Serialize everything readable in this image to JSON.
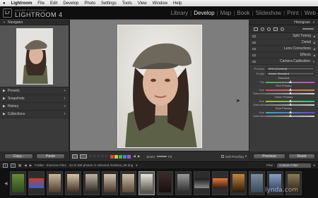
{
  "menubar": {
    "app": "Lightroom",
    "items": [
      "File",
      "Edit",
      "Develop",
      "Photo",
      "Settings",
      "Tools",
      "View",
      "Window",
      "Help"
    ]
  },
  "identity": {
    "logo": "Lr",
    "subtitle": "ADOBE PHOTOSHOP",
    "title": "LIGHTROOM 4"
  },
  "modules": [
    "Library",
    "Develop",
    "Map",
    "Book",
    "Slideshow",
    "Print",
    "Web"
  ],
  "active_module": "Develop",
  "left_panel": {
    "navigator": {
      "title": "Navigator",
      "zoom_options": [
        "FIT",
        "FILL",
        "1:1",
        "3:1"
      ]
    },
    "sections": [
      "Presets",
      "Snapshots",
      "History",
      "Collections"
    ],
    "copy_label": "Copy...",
    "paste_label": "Paste"
  },
  "toolbar": {
    "stars": "☆☆☆☆☆",
    "zoom_label": "Zoom:",
    "zoom_value": "Fit",
    "soft_proofing": "Soft Proofing",
    "flag_colors": [
      "#d44a4a",
      "#d2c33a",
      "#4bb04b",
      "#4a7fd4",
      "#9a5ad1"
    ]
  },
  "right_panel": {
    "histogram": "Histogram",
    "sections": [
      "Split Toning",
      "Detail",
      "Lens Corrections",
      "Effects",
      "Camera Calibration"
    ],
    "calibration": {
      "process_label": "Process",
      "process_value": "2012 (Current)",
      "profile_label": "Profile",
      "profile_value": "Adobe Standard",
      "groups": [
        {
          "name": "Shadows",
          "sliders": [
            {
              "label": "Tint",
              "value": 0.5
            }
          ]
        },
        {
          "name": "Red Primary",
          "sliders": [
            {
              "label": "Hue",
              "value": 0.5
            },
            {
              "label": "Saturation",
              "value": 0.5
            }
          ]
        },
        {
          "name": "Green Primary",
          "sliders": [
            {
              "label": "Hue",
              "value": 0.5
            },
            {
              "label": "Saturation",
              "value": 0.5
            }
          ]
        },
        {
          "name": "Blue Primary",
          "sliders": [
            {
              "label": "Hue",
              "value": 0.5
            },
            {
              "label": "Saturation",
              "value": 0.5
            }
          ]
        }
      ]
    },
    "previous_label": "Previous",
    "reset_label": "Reset"
  },
  "filmstrip": {
    "monitor_1": "1",
    "monitor_2": "2",
    "folder": "Folder : Exercise Files",
    "count": "43 of 105 photos /1 selected /melissa_06.dng",
    "filter_label": "Filter :",
    "filter_value": "Custom Filter",
    "thumbnails": [
      {
        "colors": [
          "#6a8b3a",
          "#2b4a1b"
        ],
        "landscape": false
      },
      {
        "colors": [
          "#c0402b",
          "#3b5fbf"
        ],
        "landscape": true
      },
      {
        "colors": [
          "#c8b79a",
          "#4a3b30"
        ],
        "landscape": false
      },
      {
        "colors": [
          "#d9c7a8",
          "#3a2a20"
        ],
        "landscape": false
      },
      {
        "colors": [
          "#bfb6a4",
          "#2c2622"
        ],
        "landscape": false
      },
      {
        "colors": [
          "#d1c4b0",
          "#45352b"
        ],
        "landscape": false
      },
      {
        "colors": [
          "#cbbfa8",
          "#5a4634"
        ],
        "landscape": false
      },
      {
        "colors": [
          "#e8e6e0",
          "#55504a"
        ],
        "landscape": false,
        "selected": true
      },
      {
        "colors": [
          "#3a2a2a",
          "#1a1010"
        ],
        "landscape": false
      },
      {
        "colors": [
          "#9a9a9a",
          "#2a2a2a"
        ],
        "landscape": false
      },
      {
        "colors": [
          "#1a1a1a",
          "#8a8a8a"
        ],
        "landscape": true
      },
      {
        "colors": [
          "#e07a3a",
          "#3a1a10"
        ],
        "landscape": true
      },
      {
        "colors": [
          "#c2873e",
          "#2a1a0a"
        ],
        "landscape": false
      },
      {
        "colors": [
          "#7a8a9a",
          "#3a4a5a"
        ],
        "landscape": false
      },
      {
        "colors": [
          "#8aa0c0",
          "#2a3a5a"
        ],
        "landscape": false
      },
      {
        "colors": [
          "#8a7a5a",
          "#2a2015"
        ],
        "landscape": false
      }
    ]
  },
  "watermark": "lynda.com"
}
